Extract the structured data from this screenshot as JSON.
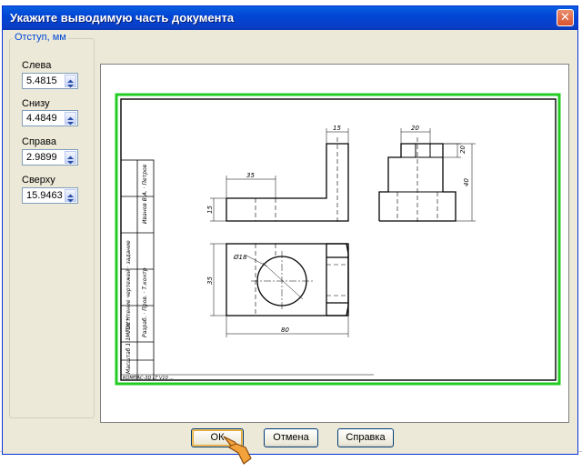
{
  "dialog": {
    "title": "Укажите выводимую часть документа",
    "close_glyph": "✕"
  },
  "margins": {
    "legend": "Отступ, мм",
    "left": {
      "label": "Слева",
      "value": "5.4815"
    },
    "bottom": {
      "label": "Снизу",
      "value": "4.4849"
    },
    "right": {
      "label": "Справа",
      "value": "2.9899"
    },
    "top": {
      "label": "Сверху",
      "value": "15.9463"
    }
  },
  "buttons": {
    "ok": "ОК",
    "cancel": "Отмена",
    "help": "Справка"
  },
  "drawing": {
    "dims": [
      "15",
      "20",
      "35",
      "15",
      "20",
      "40",
      "Ø18",
      "35",
      "80"
    ],
    "stamp_bottom": "КОМПАС-3D LT V10 ...",
    "frame_color": "#22cc22"
  },
  "icons": {
    "cursor": "hand-pointer-icon",
    "spin": "spin-arrows-icon"
  }
}
